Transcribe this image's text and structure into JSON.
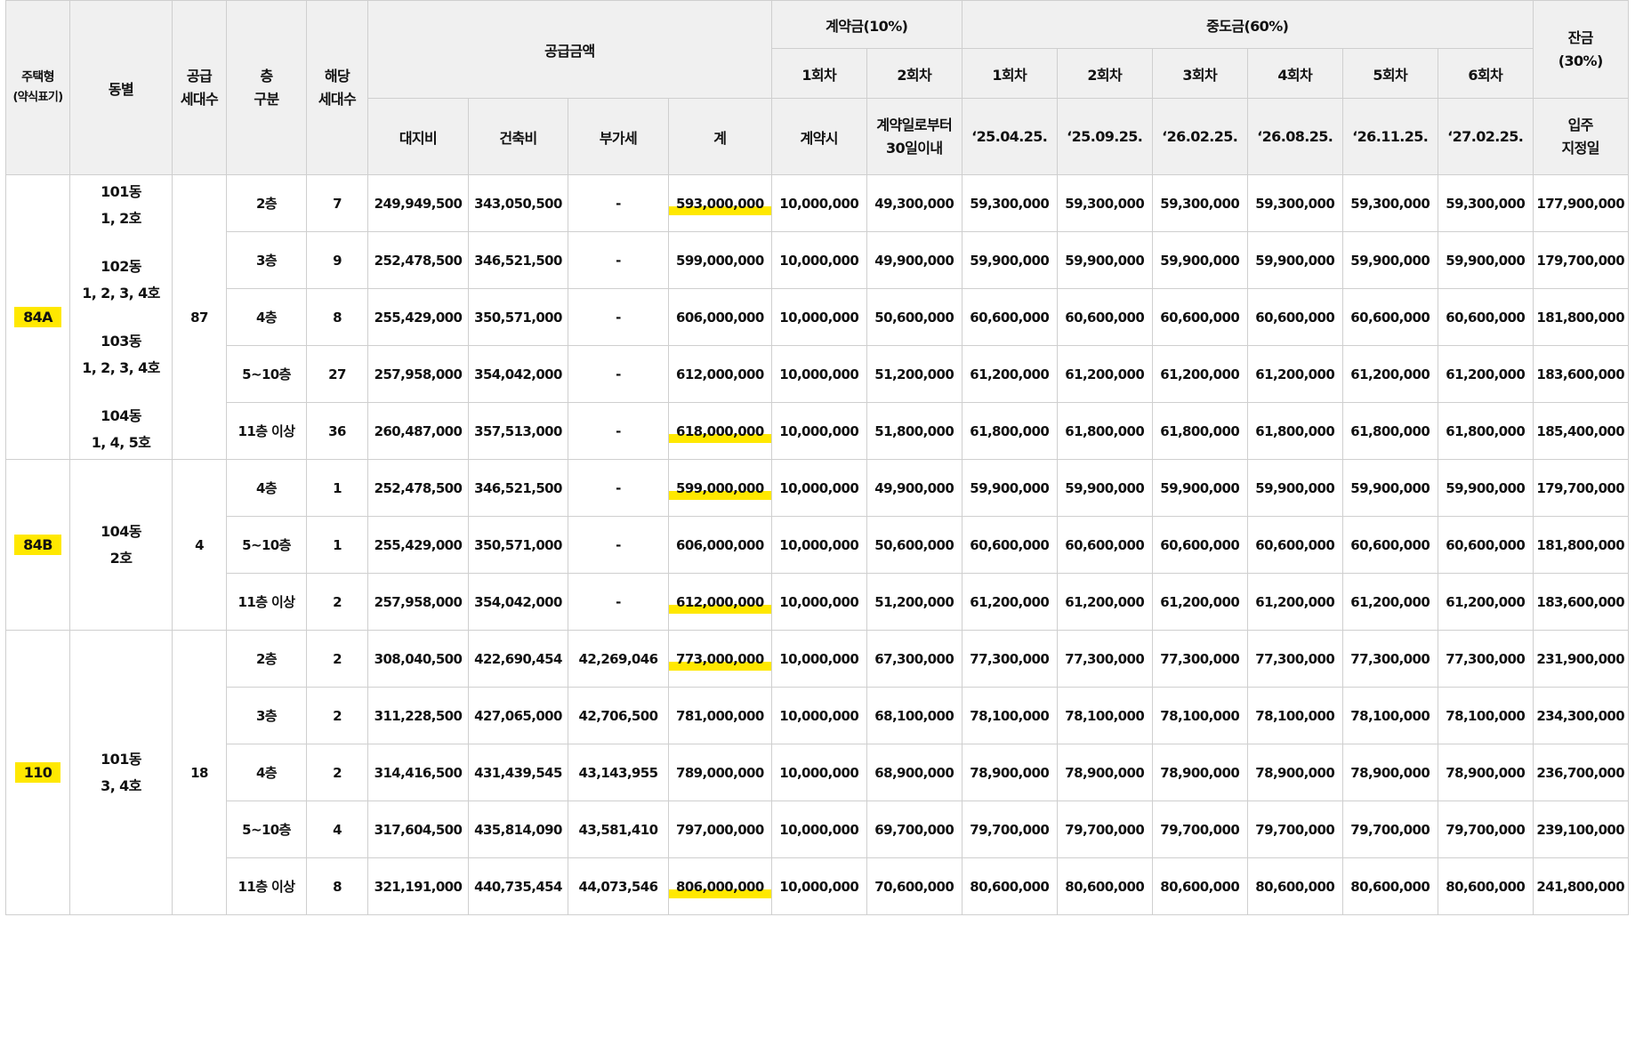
{
  "header": {
    "type": "주택형",
    "type_sub": "(약식표기)",
    "dong": "동별",
    "supply_units_l1": "공급",
    "supply_units_l2": "세대수",
    "floor_l1": "층",
    "floor_l2": "구분",
    "units_l1": "해당",
    "units_l2": "세대수",
    "supply_price": "공급금액",
    "land": "대지비",
    "building": "건축비",
    "vat": "부가세",
    "total": "계",
    "deposit": "계약금(10%)",
    "dep1": "1회차",
    "dep2": "2회차",
    "dep1_date": "계약시",
    "dep2_date_l1": "계약일로부터",
    "dep2_date_l2": "30일이내",
    "middle": "중도금(60%)",
    "mid_rounds": [
      "1회차",
      "2회차",
      "3회차",
      "4회차",
      "5회차",
      "6회차"
    ],
    "mid_dates": [
      "‘25.04.25.",
      "‘25.09.25.",
      "‘26.02.25.",
      "‘26.08.25.",
      "‘26.11.25.",
      "‘27.02.25."
    ],
    "balance_l1": "잔금",
    "balance_l2": "(30%)",
    "balance_date_l1": "입주",
    "balance_date_l2": "지정일"
  },
  "groups": [
    {
      "type": "84A",
      "dong_lines": [
        "101동",
        "1, 2호",
        "",
        "102동",
        "1, 2, 3, 4호",
        "",
        "103동",
        "1, 2, 3, 4호",
        "",
        "104동",
        "1, 4, 5호"
      ],
      "supply_units": "87",
      "rows": [
        {
          "floor": "2층",
          "units": "7",
          "land": "249,949,500",
          "building": "343,050,500",
          "vat": "-",
          "total": "593,000,000",
          "dep1": "10,000,000",
          "dep2": "49,300,000",
          "mid": [
            "59,300,000",
            "59,300,000",
            "59,300,000",
            "59,300,000",
            "59,300,000",
            "59,300,000"
          ],
          "balance": "177,900,000",
          "highlight": true
        },
        {
          "floor": "3층",
          "units": "9",
          "land": "252,478,500",
          "building": "346,521,500",
          "vat": "-",
          "total": "599,000,000",
          "dep1": "10,000,000",
          "dep2": "49,900,000",
          "mid": [
            "59,900,000",
            "59,900,000",
            "59,900,000",
            "59,900,000",
            "59,900,000",
            "59,900,000"
          ],
          "balance": "179,700,000",
          "highlight": false
        },
        {
          "floor": "4층",
          "units": "8",
          "land": "255,429,000",
          "building": "350,571,000",
          "vat": "-",
          "total": "606,000,000",
          "dep1": "10,000,000",
          "dep2": "50,600,000",
          "mid": [
            "60,600,000",
            "60,600,000",
            "60,600,000",
            "60,600,000",
            "60,600,000",
            "60,600,000"
          ],
          "balance": "181,800,000",
          "highlight": false
        },
        {
          "floor": "5~10층",
          "units": "27",
          "land": "257,958,000",
          "building": "354,042,000",
          "vat": "-",
          "total": "612,000,000",
          "dep1": "10,000,000",
          "dep2": "51,200,000",
          "mid": [
            "61,200,000",
            "61,200,000",
            "61,200,000",
            "61,200,000",
            "61,200,000",
            "61,200,000"
          ],
          "balance": "183,600,000",
          "highlight": false
        },
        {
          "floor": "11층 이상",
          "units": "36",
          "land": "260,487,000",
          "building": "357,513,000",
          "vat": "-",
          "total": "618,000,000",
          "dep1": "10,000,000",
          "dep2": "51,800,000",
          "mid": [
            "61,800,000",
            "61,800,000",
            "61,800,000",
            "61,800,000",
            "61,800,000",
            "61,800,000"
          ],
          "balance": "185,400,000",
          "highlight": true
        }
      ]
    },
    {
      "type": "84B",
      "dong_lines": [
        "104동",
        "2호"
      ],
      "supply_units": "4",
      "rows": [
        {
          "floor": "4층",
          "units": "1",
          "land": "252,478,500",
          "building": "346,521,500",
          "vat": "-",
          "total": "599,000,000",
          "dep1": "10,000,000",
          "dep2": "49,900,000",
          "mid": [
            "59,900,000",
            "59,900,000",
            "59,900,000",
            "59,900,000",
            "59,900,000",
            "59,900,000"
          ],
          "balance": "179,700,000",
          "highlight": true
        },
        {
          "floor": "5~10층",
          "units": "1",
          "land": "255,429,000",
          "building": "350,571,000",
          "vat": "-",
          "total": "606,000,000",
          "dep1": "10,000,000",
          "dep2": "50,600,000",
          "mid": [
            "60,600,000",
            "60,600,000",
            "60,600,000",
            "60,600,000",
            "60,600,000",
            "60,600,000"
          ],
          "balance": "181,800,000",
          "highlight": false
        },
        {
          "floor": "11층 이상",
          "units": "2",
          "land": "257,958,000",
          "building": "354,042,000",
          "vat": "-",
          "total": "612,000,000",
          "dep1": "10,000,000",
          "dep2": "51,200,000",
          "mid": [
            "61,200,000",
            "61,200,000",
            "61,200,000",
            "61,200,000",
            "61,200,000",
            "61,200,000"
          ],
          "balance": "183,600,000",
          "highlight": true
        }
      ]
    },
    {
      "type": "110",
      "dong_lines": [
        "101동",
        "3, 4호"
      ],
      "supply_units": "18",
      "rows": [
        {
          "floor": "2층",
          "units": "2",
          "land": "308,040,500",
          "building": "422,690,454",
          "vat": "42,269,046",
          "total": "773,000,000",
          "dep1": "10,000,000",
          "dep2": "67,300,000",
          "mid": [
            "77,300,000",
            "77,300,000",
            "77,300,000",
            "77,300,000",
            "77,300,000",
            "77,300,000"
          ],
          "balance": "231,900,000",
          "highlight": true
        },
        {
          "floor": "3층",
          "units": "2",
          "land": "311,228,500",
          "building": "427,065,000",
          "vat": "42,706,500",
          "total": "781,000,000",
          "dep1": "10,000,000",
          "dep2": "68,100,000",
          "mid": [
            "78,100,000",
            "78,100,000",
            "78,100,000",
            "78,100,000",
            "78,100,000",
            "78,100,000"
          ],
          "balance": "234,300,000",
          "highlight": false
        },
        {
          "floor": "4층",
          "units": "2",
          "land": "314,416,500",
          "building": "431,439,545",
          "vat": "43,143,955",
          "total": "789,000,000",
          "dep1": "10,000,000",
          "dep2": "68,900,000",
          "mid": [
            "78,900,000",
            "78,900,000",
            "78,900,000",
            "78,900,000",
            "78,900,000",
            "78,900,000"
          ],
          "balance": "236,700,000",
          "highlight": false
        },
        {
          "floor": "5~10층",
          "units": "4",
          "land": "317,604,500",
          "building": "435,814,090",
          "vat": "43,581,410",
          "total": "797,000,000",
          "dep1": "10,000,000",
          "dep2": "69,700,000",
          "mid": [
            "79,700,000",
            "79,700,000",
            "79,700,000",
            "79,700,000",
            "79,700,000",
            "79,700,000"
          ],
          "balance": "239,100,000",
          "highlight": false
        },
        {
          "floor": "11층 이상",
          "units": "8",
          "land": "321,191,000",
          "building": "440,735,454",
          "vat": "44,073,546",
          "total": "806,000,000",
          "dep1": "10,000,000",
          "dep2": "70,600,000",
          "mid": [
            "80,600,000",
            "80,600,000",
            "80,600,000",
            "80,600,000",
            "80,600,000",
            "80,600,000"
          ],
          "balance": "241,800,000",
          "highlight": true
        }
      ]
    }
  ],
  "colors": {
    "highlight": "#ffe800",
    "header_bg": "#f0f0f0",
    "border": "#cfcfcf"
  }
}
